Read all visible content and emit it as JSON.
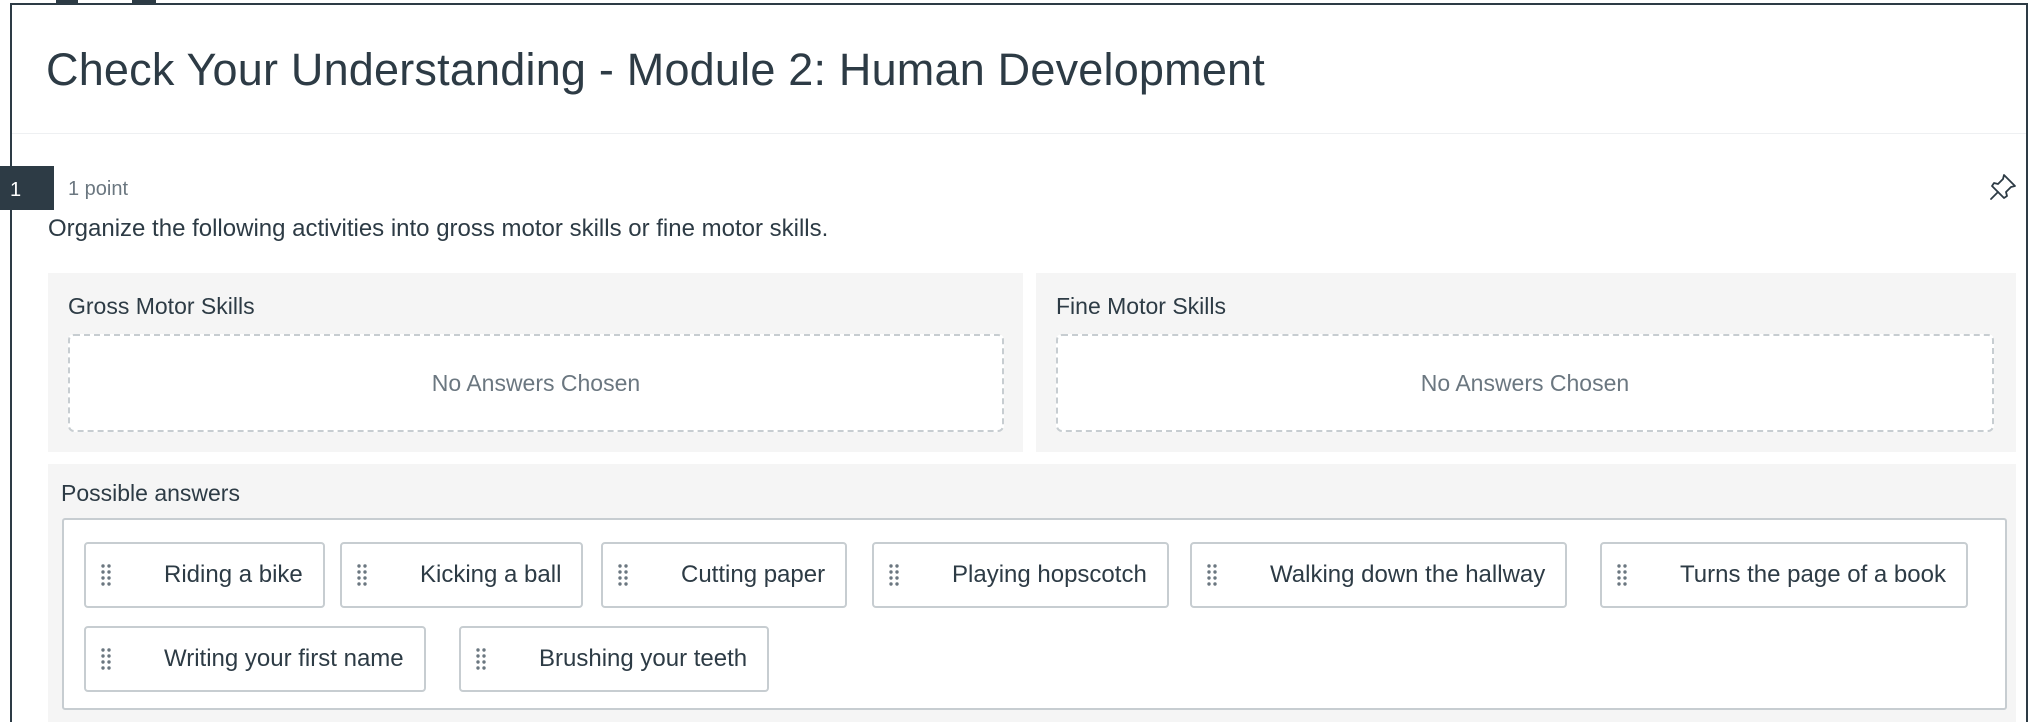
{
  "quiz": {
    "title": "Check Your Understanding - Module 2: Human Development",
    "question": {
      "number": "1",
      "points": "1 point",
      "prompt": "Organize the following activities into gross motor skills or fine motor skills."
    },
    "categories": [
      {
        "label": "Gross Motor Skills",
        "empty_text": "No Answers Chosen"
      },
      {
        "label": "Fine Motor Skills",
        "empty_text": "No Answers Chosen"
      }
    ],
    "possible_answers": {
      "label": "Possible answers",
      "items": [
        "Riding a bike",
        "Kicking a ball",
        "Cutting paper",
        "Playing hopscotch",
        "Walking down the hallway",
        "Turns the page of a book",
        "Writing your first name",
        "Brushing your teeth"
      ]
    }
  },
  "icons": {
    "pin": "pin-icon",
    "drag_handle": "drag-handle-icon"
  },
  "colors": {
    "primary_dark": "#2d3b45",
    "muted_text": "#6b7780",
    "panel_bg": "#f5f5f5",
    "border": "#c7cdd1"
  }
}
